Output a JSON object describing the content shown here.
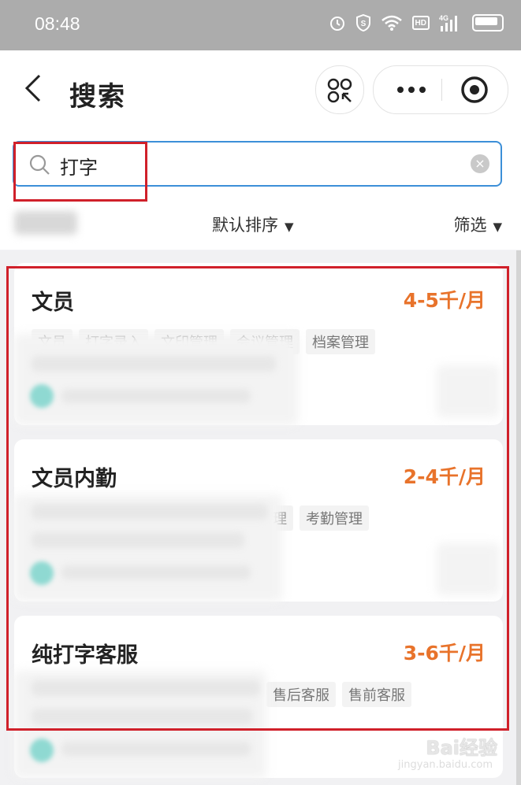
{
  "status_bar": {
    "time": "08:48",
    "network": "4G",
    "hd": "HD"
  },
  "nav": {
    "title": "搜索"
  },
  "search": {
    "value": "打字",
    "clear": "×"
  },
  "filters": {
    "sort_label": "默认排序",
    "filter_label": "筛选"
  },
  "jobs": [
    {
      "title": "文员",
      "salary": "4-5千/月",
      "tags": [
        "文员",
        "打字录入",
        "文印管理",
        "会议管理",
        "档案管理"
      ]
    },
    {
      "title": "文员内勤",
      "salary": "2-4千/月",
      "tags": [
        "管理",
        "考勤管理"
      ]
    },
    {
      "title": "纯打字客服",
      "salary": "3-6千/月",
      "tags": [
        "售后客服",
        "售前客服"
      ]
    }
  ],
  "watermark": {
    "brand": "Bai经验",
    "url": "jingyan.baidu.com"
  },
  "colors": {
    "accent": "#e8732b",
    "focus": "#3c8fd8",
    "highlight": "#d0202a"
  }
}
